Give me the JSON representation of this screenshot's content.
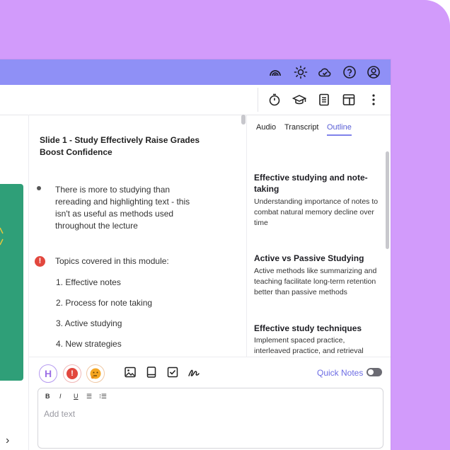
{
  "topbar": {
    "icons": [
      "rainbow-icon",
      "sun-icon",
      "cloud-check-icon",
      "help-icon",
      "user-icon"
    ]
  },
  "toolbar": {
    "icons": [
      "timer-icon",
      "graduation-cap-icon",
      "notes-icon",
      "layout-icon",
      "more-vert-icon"
    ]
  },
  "sidebar": {
    "expand_glyph": "›"
  },
  "slide": {
    "title": "Slide 1 - Study Effectively Raise Grades Boost Confidence",
    "bullet": "There is more to studying than rereading and highlighting text - this isn't as useful as methods used throughout the lecture",
    "alert_glyph": "!",
    "topics_intro": "Topics covered in this module:",
    "topics": [
      "1. Effective notes",
      "2. Process for note taking",
      "3. Active studying",
      "4. New strategies"
    ]
  },
  "right_panel": {
    "tabs": [
      {
        "label": "Audio",
        "active": false
      },
      {
        "label": "Transcript",
        "active": false
      },
      {
        "label": "Outline",
        "active": true
      }
    ],
    "outline": [
      {
        "title": "Effective studying and note-taking",
        "text": "Understanding importance of notes to combat natural memory decline over time"
      },
      {
        "title": "Active vs Passive Studying",
        "text": "Active methods like summarizing and teaching facilitate long-term retention better than passive methods"
      },
      {
        "title": "Effective study techniques",
        "text": "Implement spaced practice, interleaved practice, and retrieval"
      }
    ]
  },
  "notes": {
    "h_badge": "H",
    "alert_glyph": "!",
    "quick_notes_label": "Quick Notes",
    "quick_notes_on": false,
    "format_buttons": [
      "B",
      "I",
      "U",
      "☰",
      "⁝☰"
    ],
    "placeholder": "Add text"
  },
  "colors": {
    "background": "#d29bfb",
    "topbar": "#8f90f6",
    "accent": "#6d6de4",
    "alert": "#e2473e",
    "green_panel": "#2f9f78"
  }
}
